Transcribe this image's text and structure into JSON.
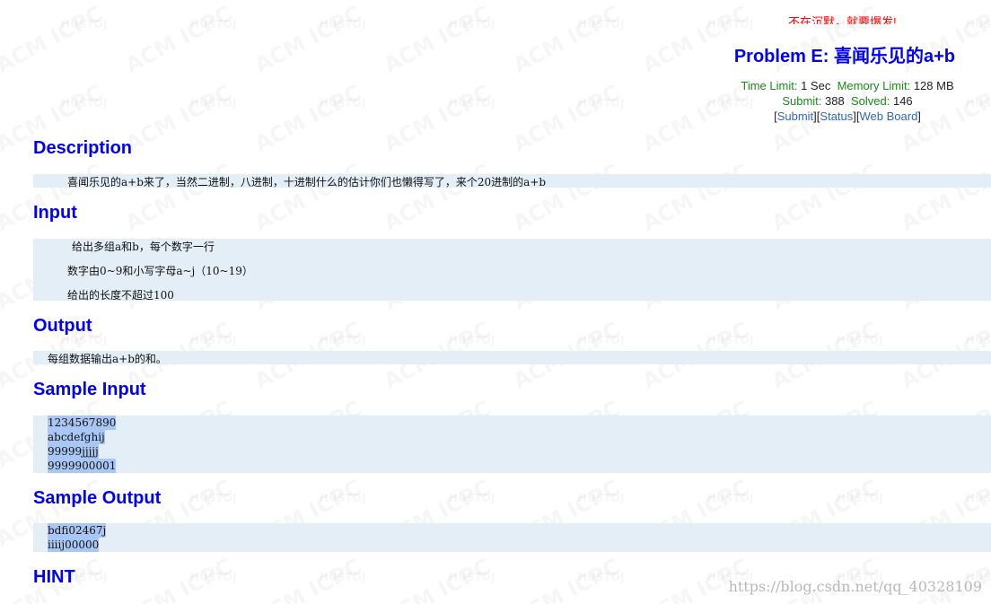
{
  "header": {
    "problem_title": "Problem E: 喜闻乐见的a+b",
    "time_limit_label": "Time Limit:",
    "time_limit_value": "1 Sec",
    "memory_limit_label": "Memory Limit:",
    "memory_limit_value": "128 MB",
    "submit_label": "Submit:",
    "submit_value": "388",
    "solved_label": "Solved:",
    "solved_value": "146",
    "links": [
      "Submit",
      "Status",
      "Web Board"
    ],
    "marquee_text": "不在沉默，就要爆发!"
  },
  "sections": {
    "description_title": "Description",
    "description_text": "喜闻乐见的a+b来了，当然二进制，八进制，十进制什么的估计你们也懒得写了，来个20进制的a+b",
    "input_title": "Input",
    "input_lines": [
      "给出多组a和b，每个数字一行",
      "数字由0~9和小写字母a~j（10~19）",
      "给出的长度不超过100"
    ],
    "output_title": "Output",
    "output_text": "每组数据输出a+b的和。",
    "sample_input_title": "Sample Input",
    "sample_input_lines": [
      "1234567890",
      "abcdefghij",
      "99999jjjjj",
      "9999900001"
    ],
    "sample_output_title": "Sample Output",
    "sample_output_lines": [
      "bdfi02467j",
      "iiiij00000"
    ],
    "hint_title": "HINT"
  },
  "watermark": {
    "big_text": "ACM ICPC",
    "small_text": "HUSTOJ",
    "blog_url": "https://blog.csdn.net/qq_40328109"
  },
  "colors": {
    "title_blue": "#0000ff",
    "label_green": "#1a8a1a",
    "link_blue": "#3366bb",
    "block_bg": "#e3eef7",
    "selection_bg": "#a9c7f5"
  }
}
